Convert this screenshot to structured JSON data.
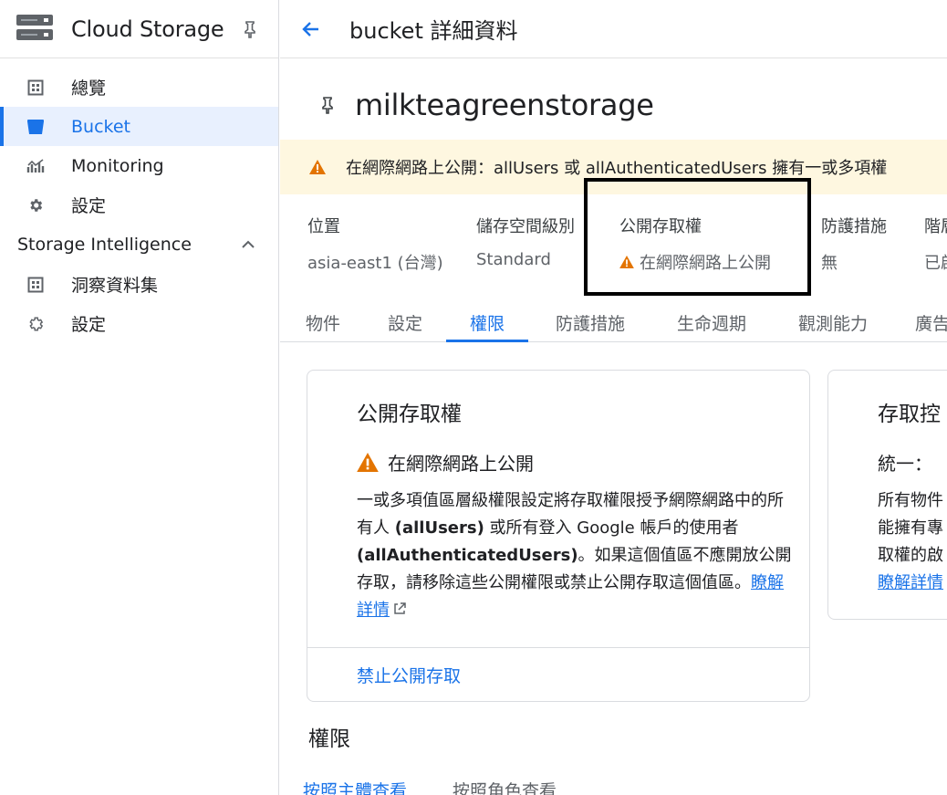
{
  "sidebar": {
    "product_title": "Cloud Storage",
    "items": [
      {
        "label": "總覽",
        "icon": "dashboard-icon"
      },
      {
        "label": "Bucket",
        "icon": "bucket-icon"
      },
      {
        "label": "Monitoring",
        "icon": "monitoring-icon"
      },
      {
        "label": "設定",
        "icon": "gear-icon"
      }
    ],
    "section_title": "Storage Intelligence",
    "section_items": [
      {
        "label": "洞察資料集",
        "icon": "dataset-icon"
      },
      {
        "label": "設定",
        "icon": "gear-outline-icon"
      }
    ]
  },
  "header": {
    "title": "bucket 詳細資料"
  },
  "bucket": {
    "name": "milkteagreenstorage"
  },
  "banner": {
    "text": "在網際網路上公開：allUsers 或 allAuthenticatedUsers 擁有一或多項權"
  },
  "properties": [
    {
      "label": "位置",
      "value": "asia-east1 (台灣)"
    },
    {
      "label": "儲存空間級別",
      "value": "Standard"
    },
    {
      "label": "公開存取權",
      "value": "在網際網路上公開"
    },
    {
      "label": "防護措施",
      "value": "無"
    },
    {
      "label": "階層",
      "value": "已啟"
    }
  ],
  "tabs": [
    "物件",
    "設定",
    "權限",
    "防護措施",
    "生命週期",
    "觀測能力",
    "廣告"
  ],
  "active_tab": "權限",
  "public_access_card": {
    "title": "公開存取權",
    "status": "在網際網路上公開",
    "desc_1": "一或多項值區層級權限設定將存取權限授予網際網路中的所有人 ",
    "desc_allusers": "(allUsers)",
    "desc_2": " 或所有登入 Google 帳戶的使用者 ",
    "desc_allauth": "(allAuthenticatedUsers)",
    "desc_3": "。如果這個值區不應開放公開存取，請移除這些公開權限或禁止公開存取這個值區。",
    "learn_more": "瞭解詳情",
    "action": "禁止公開存取"
  },
  "access_control_card": {
    "title": "存取控",
    "subtitle": "統一：",
    "line1": "所有物件",
    "line2": "能擁有專",
    "line3": "取權的啟",
    "link": "瞭解詳情"
  },
  "permissions": {
    "title": "權限",
    "subtabs": [
      "按照主體查看",
      "按照角色查看"
    ]
  },
  "colors": {
    "accent": "#1a73e8",
    "warning": "#e37400",
    "banner_bg": "#fef7e0"
  }
}
